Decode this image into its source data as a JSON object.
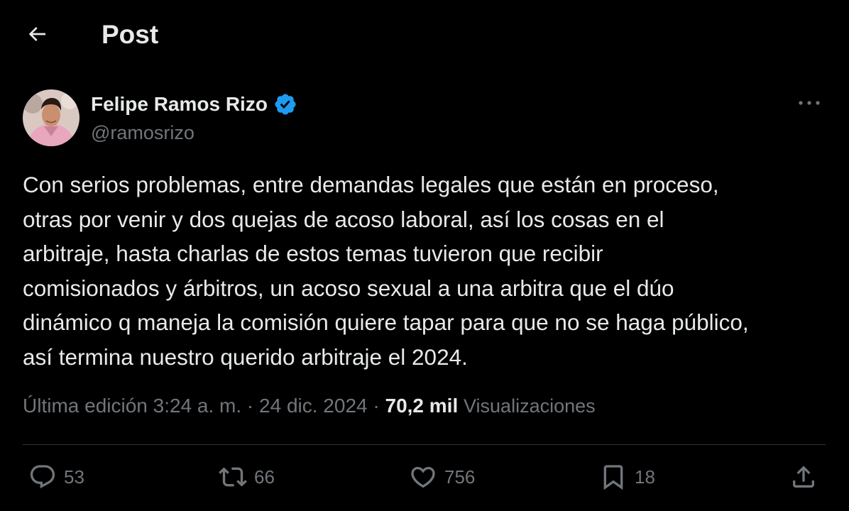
{
  "header": {
    "back_icon": "arrow-left-icon",
    "title": "Post"
  },
  "author": {
    "display_name": "Felipe Ramos Rizo",
    "handle": "@ramosrizo",
    "verified_icon": "verified-badge-icon",
    "verified_color": "#1d9bf0",
    "more_icon": "more-horizontal-icon"
  },
  "tweet": {
    "lines": [
      "Con serios problemas, entre demandas legales que están en proceso,",
      "otras por venir y dos quejas de acoso laboral, así los cosas en el",
      "arbitraje, hasta charlas de estos temas tuvieron que recibir",
      "comisionados y árbitros, un acoso sexual  a una arbitra que el dúo",
      "dinámico q maneja la comisión quiere tapar para que no se haga público,",
      "así termina nuestro querido arbitraje el 2024."
    ]
  },
  "meta": {
    "edited_time": "Última edición 3:24 a. m.",
    "separator": "·",
    "date": "24 dic. 2024",
    "views_count": "70,2 mil",
    "views_label": "Visualizaciones"
  },
  "actions": {
    "replies": "53",
    "reposts": "66",
    "likes": "756",
    "bookmarks": "18"
  },
  "colors": {
    "background": "#000000",
    "text_primary": "#e7e9ea",
    "text_secondary": "#71767b",
    "divider": "#2f3336"
  }
}
